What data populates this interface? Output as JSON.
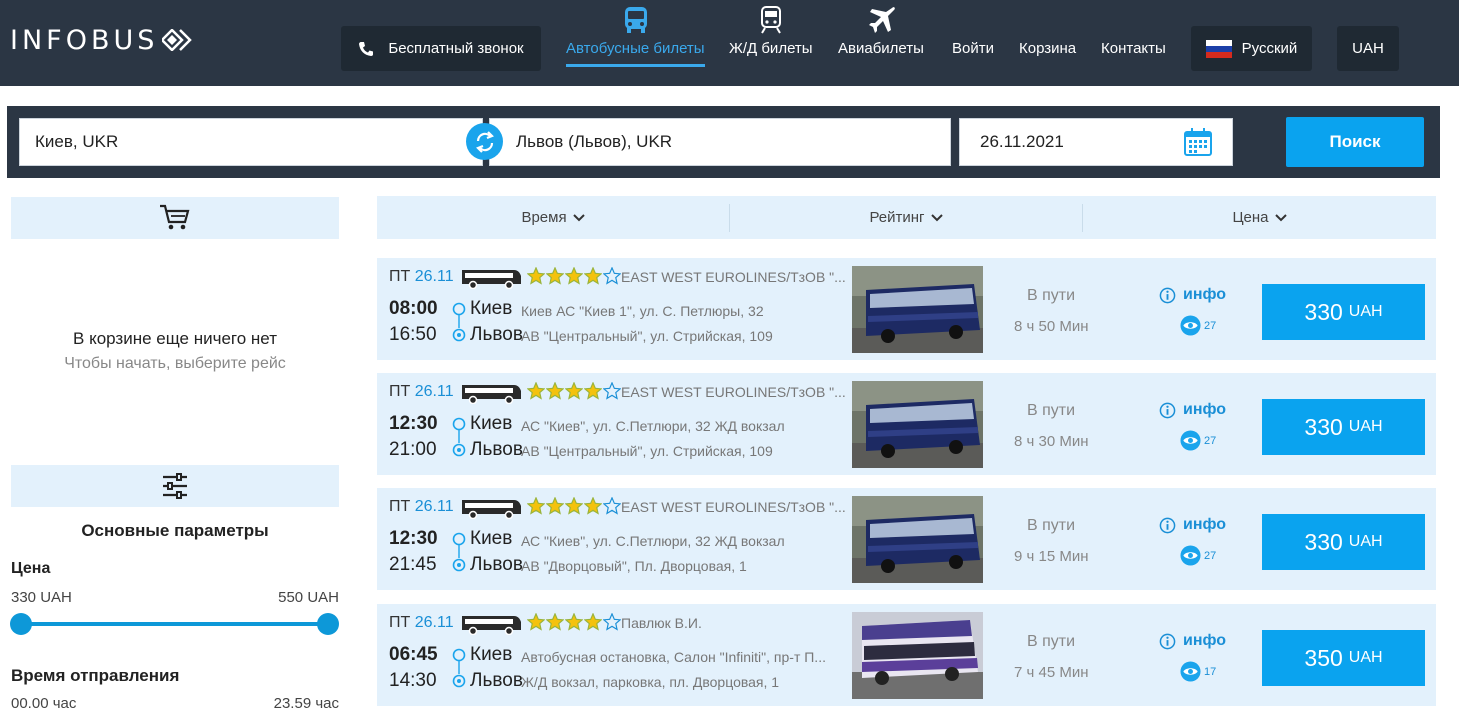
{
  "header": {
    "logo_text": "INFOBUS",
    "free_call": "Бесплатный звонок",
    "nav": [
      {
        "label": "Автобусные билеты",
        "icon": "bus-icon",
        "active": true
      },
      {
        "label": "Ж/Д билеты",
        "icon": "train-icon",
        "active": false
      },
      {
        "label": "Авиабилеты",
        "icon": "plane-icon",
        "active": false
      },
      {
        "label": "Войти"
      },
      {
        "label": "Корзина"
      },
      {
        "label": "Контакты"
      }
    ],
    "language": "Русский",
    "currency": "UAH"
  },
  "search": {
    "from": "Киев, UKR",
    "to": "Львов (Львов), UKR",
    "date": "26.11.2021",
    "button": "Поиск"
  },
  "sort": {
    "time": "Время",
    "rating": "Рейтинг",
    "price": "Цена"
  },
  "cart": {
    "empty_title": "В корзине еще ничего нет",
    "empty_hint": "Чтобы начать, выберите рейс"
  },
  "filters": {
    "title": "Основные параметры",
    "price_label": "Цена",
    "price_min": "330 UAH",
    "price_max": "550 UAH",
    "departure_label": "Время отправления",
    "time_min": "00.00 час",
    "time_max": "23.59 час"
  },
  "trips": [
    {
      "day": "ПТ",
      "date": "26.11",
      "rating": 4,
      "carrier": "EAST WEST EUROLINES/ТзОВ \"...",
      "dep_time": "08:00",
      "arr_time": "16:50",
      "from_city": "Киев",
      "from_addr": "Киев АС \"Киев 1\", ул. С. Петлюры, 32",
      "to_city": "Львов",
      "to_addr": "АВ \"Центральный\", ул. Стрийская, 109",
      "way_label": "В пути",
      "duration": "8 ч 50 Мин",
      "info": "инфо",
      "views": "27",
      "price": "330",
      "currency": "UAH",
      "photo": "blue"
    },
    {
      "day": "ПТ",
      "date": "26.11",
      "rating": 4,
      "carrier": "EAST WEST EUROLINES/ТзОВ \"...",
      "dep_time": "12:30",
      "arr_time": "21:00",
      "from_city": "Киев",
      "from_addr": "АС \"Киев\", ул. С.Петлюри, 32 ЖД вокзал",
      "to_city": "Львов",
      "to_addr": "АВ \"Центральный\", ул. Стрийская, 109",
      "way_label": "В пути",
      "duration": "8 ч 30 Мин",
      "info": "инфо",
      "views": "27",
      "price": "330",
      "currency": "UAH",
      "photo": "blue"
    },
    {
      "day": "ПТ",
      "date": "26.11",
      "rating": 4,
      "carrier": "EAST WEST EUROLINES/ТзОВ \"...",
      "dep_time": "12:30",
      "arr_time": "21:45",
      "from_city": "Киев",
      "from_addr": "АС \"Киев\", ул. С.Петлюри, 32 ЖД вокзал",
      "to_city": "Львов",
      "to_addr": "АВ \"Дворцовый\", Пл. Дворцовая, 1",
      "way_label": "В пути",
      "duration": "9 ч 15 Мин",
      "info": "инфо",
      "views": "27",
      "price": "330",
      "currency": "UAH",
      "photo": "blue"
    },
    {
      "day": "ПТ",
      "date": "26.11",
      "rating": 4,
      "carrier": "Павлюк В.И.",
      "dep_time": "06:45",
      "arr_time": "14:30",
      "from_city": "Киев",
      "from_addr": "Автобусная остановка, Салон \"Infiniti\", пр-т П...",
      "to_city": "Львов",
      "to_addr": "Ж/Д вокзал, парковка, пл. Дворцовая, 1",
      "way_label": "В пути",
      "duration": "7 ч 45 Мин",
      "info": "инфо",
      "views": "17",
      "price": "350",
      "currency": "UAH",
      "photo": "purple"
    }
  ]
}
